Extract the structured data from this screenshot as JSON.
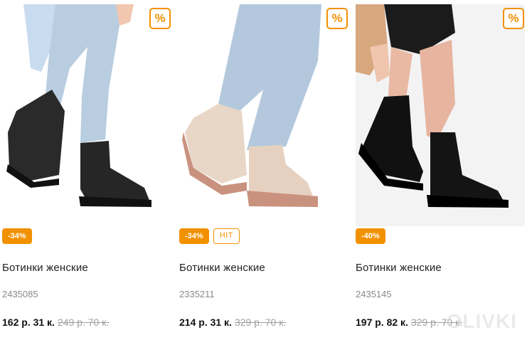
{
  "percent_icon": "%",
  "watermark": "OLIVKI",
  "products": [
    {
      "badges": [
        "-34%"
      ],
      "title": "Ботинки женские",
      "sku": "2435085",
      "price": "162 р. 31 к.",
      "old_price": "249 р. 70 к."
    },
    {
      "badges": [
        "-34%",
        "HIT"
      ],
      "title": "Ботинки женские",
      "sku": "2335211",
      "price": "214 р. 31 к.",
      "old_price": "329 р. 70 к."
    },
    {
      "badges": [
        "-40%"
      ],
      "title": "Ботинки женские",
      "sku": "2435145",
      "price": "197 р. 82 к.",
      "old_price": "329 р. 70 к."
    }
  ],
  "colors": {
    "accent": "#f29100"
  }
}
